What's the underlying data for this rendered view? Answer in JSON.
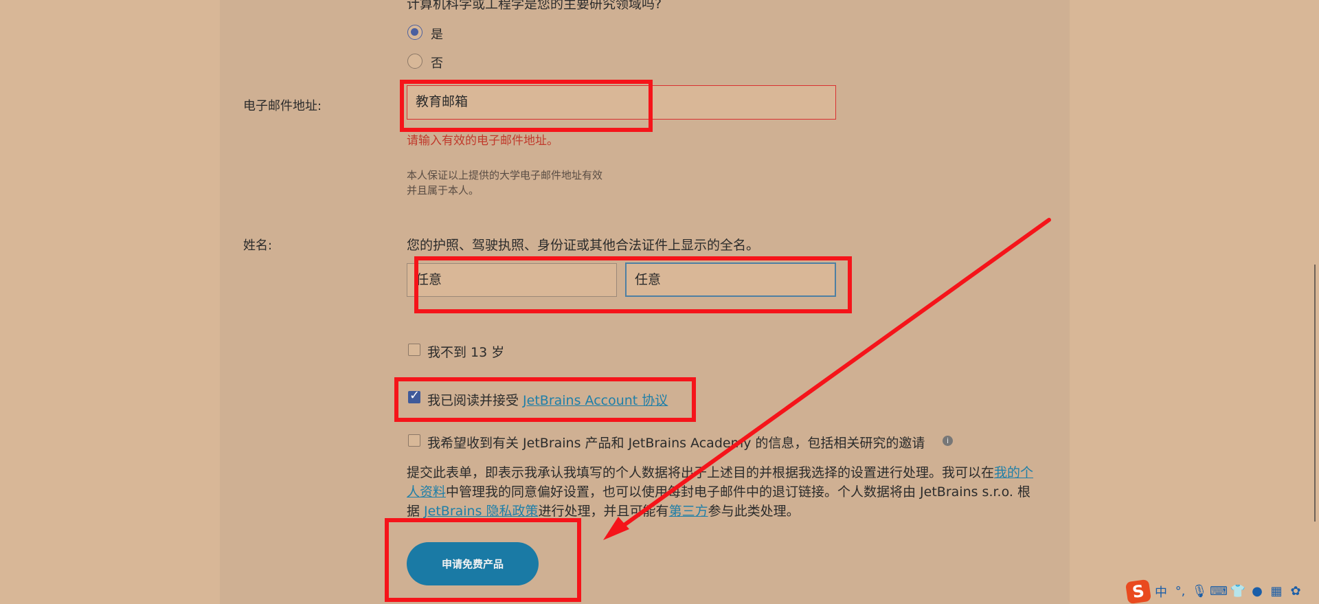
{
  "question": "计算机科学或工程学是您的主要研究领域吗?",
  "radio_yes": "是",
  "radio_no": "否",
  "email": {
    "label": "电子邮件地址:",
    "value": "教育邮箱",
    "error": "请输入有效的电子邮件地址。",
    "note_line1": "本人保证以上提供的大学电子邮件地址有效",
    "note_line2": "并且属于本人。"
  },
  "name": {
    "label": "姓名:",
    "hint": "您的护照、驾驶执照、身份证或其他合法证件上显示的全名。",
    "first_value": "任意",
    "last_value": "任意"
  },
  "checkboxes": {
    "under13": "我不到 13 岁",
    "agree_prefix": "我已阅读并接受 ",
    "agree_link": "JetBrains Account 协议",
    "newsletter": "我希望收到有关 JetBrains 产品和 JetBrains Academy 的信息，包括相关研究的邀请"
  },
  "legal": {
    "part1": "提交此表单，即表示我承认我填写的个人数据将出于上述目的并根据我选择的设置进行处理。我可以在",
    "link1": "我的个人资料",
    "part2": "中管理我的同意偏好设置，也可以使用每封电子邮件中的退订链接。个人数据将由 JetBrains s.r.o. 根据 ",
    "link2": "JetBrains 隐私政策",
    "part3": "进行处理，并且可能有",
    "link3": "第三方",
    "part4": "参与此类处理。"
  },
  "submit_label": "申请免费产品",
  "tray": {
    "ime_logo": "S",
    "lang": "中"
  },
  "colors": {
    "annotation": "#f5141a",
    "button": "#1a7aa5",
    "link": "#1f7fa8"
  }
}
